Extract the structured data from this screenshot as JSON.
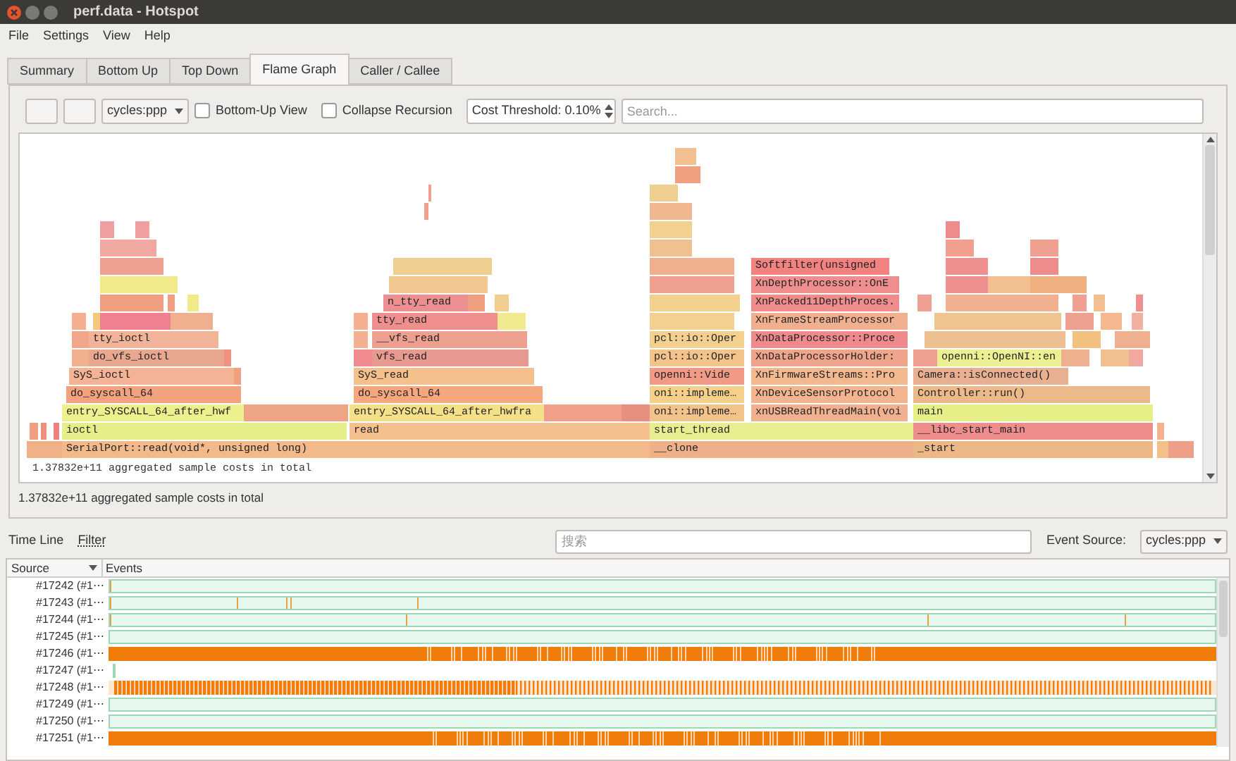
{
  "window": {
    "title": "perf.data - Hotspot"
  },
  "menu": [
    "File",
    "Settings",
    "View",
    "Help"
  ],
  "tabs": [
    {
      "label": "Summary",
      "selected": false
    },
    {
      "label": "Bottom Up",
      "selected": false
    },
    {
      "label": "Top Down",
      "selected": false
    },
    {
      "label": "Flame Graph",
      "selected": true
    },
    {
      "label": "Caller / Callee",
      "selected": false
    }
  ],
  "toolbar": {
    "event_combo": "cycles:ppp",
    "bottom_up": {
      "label": "Bottom-Up View",
      "checked": false
    },
    "collapse": {
      "label": "Collapse Recursion",
      "checked": false
    },
    "cost_threshold": "Cost Threshold: 0.10%",
    "search": {
      "placeholder": "Search..."
    }
  },
  "flame_frames": [
    {
      "label": "Softfilter(unsigned",
      "color": "#f2827f"
    },
    {
      "label": "XnDepthProcessor::OnE",
      "color": "#ef8e8e"
    },
    {
      "label": "n_tty_read",
      "color": "#ec8f90"
    },
    {
      "label": "XnPacked11DepthProces.",
      "color": "#ef8c8c"
    },
    {
      "label": "tty_read",
      "color": "#ee8f8e"
    },
    {
      "label": "XnFrameStreamProcessor",
      "color": "#f0b090"
    },
    {
      "label": "tty_ioctl",
      "color": "#f1b498"
    },
    {
      "label": "__vfs_read",
      "color": "#eea090"
    },
    {
      "label": "pcl::io::Oper",
      "color": "#f3d090"
    },
    {
      "label": "XnDataProcessor::Proce",
      "color": "#ef8a8c"
    },
    {
      "label": "do_vfs_ioctl",
      "color": "#e8a890"
    },
    {
      "label": "vfs_read",
      "color": "#e89a90"
    },
    {
      "label": "pcl::io::Oper",
      "color": "#f3c38c"
    },
    {
      "label": "XnDataProcessorHolder:",
      "color": "#efa58c"
    },
    {
      "label": "openni::OpenNI::en",
      "color": "#ecef92"
    },
    {
      "label": "SyS_ioctl",
      "color": "#f4b394"
    },
    {
      "label": "SyS_read",
      "color": "#f4c08c"
    },
    {
      "label": "openni::Vide",
      "color": "#f19a86"
    },
    {
      "label": "XnFirmwareStreams::Pro",
      "color": "#f2b88e"
    },
    {
      "label": "Camera::isConnected()",
      "color": "#e8b090"
    },
    {
      "label": "do_syscall_64",
      "color": "#f3a27f"
    },
    {
      "label": "do_syscall_64",
      "color": "#f5a880"
    },
    {
      "label": "oni::impleme…",
      "color": "#f5d08a"
    },
    {
      "label": "XnDeviceSensorProtocol",
      "color": "#f3b490"
    },
    {
      "label": "Controller::run()",
      "color": "#ecba8a"
    },
    {
      "label": "entry_SYSCALL_64_after_hwf",
      "color": "#eef08e"
    },
    {
      "label": "entry_SYSCALL_64_after_hwfra",
      "color": "#f5e08a"
    },
    {
      "label": "oni::impleme…",
      "color": "#f3c38c"
    },
    {
      "label": "xnUSBReadThreadMain(voi",
      "color": "#f1b090"
    },
    {
      "label": "main",
      "color": "#e6ee88"
    },
    {
      "label": "ioctl",
      "color": "#e6ee8a"
    },
    {
      "label": "read",
      "color": "#f4c08e"
    },
    {
      "label": "start_thread",
      "color": "#e8ee90"
    },
    {
      "label": "__libc_start_main",
      "color": "#ef8c8c"
    },
    {
      "label": "SerialPort::read(void*, unsigned long)",
      "color": "#f2b98a"
    },
    {
      "label": "__clone",
      "color": "#eeb088"
    },
    {
      "label": "_start",
      "color": "#ecb888"
    }
  ],
  "flame_total": "1.37832e+11 aggregated sample costs in total",
  "total_below": "1.37832e+11 aggregated sample costs in total",
  "timeline": {
    "title": "Time Line",
    "filter": "Filter",
    "search": {
      "placeholder": "搜索"
    },
    "event_source_label": "Event Source:",
    "event_source": "cycles:ppp",
    "columns": [
      "Source",
      "Events"
    ],
    "rows": [
      {
        "source": "#17242 (#1⋯",
        "kind": "ticks"
      },
      {
        "source": "#17243 (#1⋯",
        "kind": "ticks"
      },
      {
        "source": "#17244 (#1⋯",
        "kind": "ticks"
      },
      {
        "source": "#17245 (#1⋯",
        "kind": "ticks"
      },
      {
        "source": "#17246 (#1⋯",
        "kind": "busy"
      },
      {
        "source": "#17247 (#1⋯",
        "kind": "blank"
      },
      {
        "source": "#17248 (#1⋯",
        "kind": "striped"
      },
      {
        "source": "#17249 (#1⋯",
        "kind": "ticks"
      },
      {
        "source": "#17250 (#1⋯",
        "kind": "ticks"
      },
      {
        "source": "#17251 (#1⋯",
        "kind": "busy"
      }
    ]
  }
}
